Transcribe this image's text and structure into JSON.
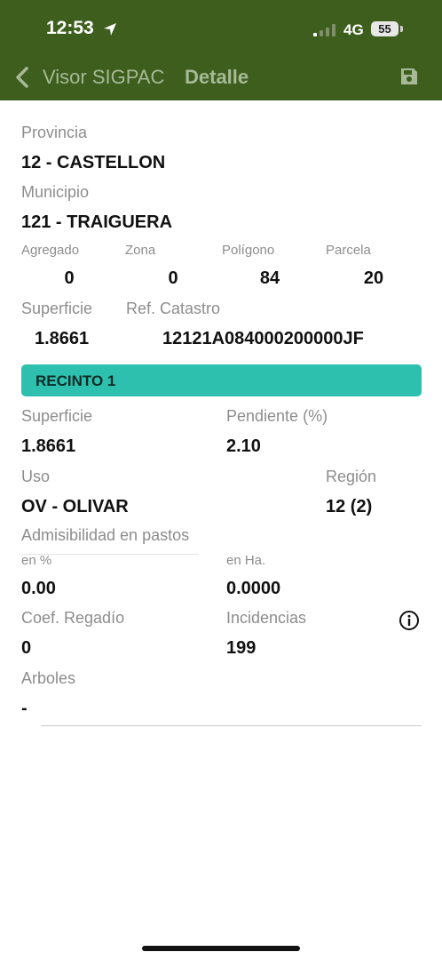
{
  "status": {
    "time": "12:53",
    "network": "4G",
    "battery": "55"
  },
  "nav": {
    "back_label": "Visor SIGPAC",
    "title": "Detalle"
  },
  "parcel": {
    "provincia_label": "Provincia",
    "provincia_value": "12 - CASTELLON",
    "municipio_label": "Municipio",
    "municipio_value": "121 - TRAIGUERA",
    "agregado_label": "Agregado",
    "agregado_value": "0",
    "zona_label": "Zona",
    "zona_value": "0",
    "poligono_label": "Polígono",
    "poligono_value": "84",
    "parcela_label": "Parcela",
    "parcela_value": "20",
    "superficie_label": "Superficie",
    "superficie_value": "1.8661",
    "catastro_label": "Ref. Catastro",
    "catastro_value": "12121A084000200000JF"
  },
  "recinto": {
    "header": "RECINTO 1",
    "superficie_label": "Superficie",
    "superficie_value": "1.8661",
    "pendiente_label": "Pendiente (%)",
    "pendiente_value": "2.10",
    "uso_label": "Uso",
    "uso_value": "OV - OLIVAR",
    "region_label": "Región",
    "region_value": "12 (2)",
    "admisibilidad_label": "Admisibilidad en pastos",
    "pct_label": "en %",
    "pct_value": "0.00",
    "ha_label": "en Ha.",
    "ha_value": "0.0000",
    "regadio_label": "Coef. Regadío",
    "regadio_value": "0",
    "incidencias_label": "Incidencias",
    "incidencias_value": "199",
    "arboles_label": "Arboles",
    "arboles_value": "-"
  },
  "icons": {
    "back": "chevron-left-icon",
    "save": "floppy-disk-icon",
    "info": "info-circle-icon",
    "location": "location-arrow-icon",
    "signal": "signal-icon"
  },
  "colors": {
    "header_bg": "#3e5e1e",
    "header_text": "#a7b996",
    "recinto_bg": "#2ec0ae"
  }
}
